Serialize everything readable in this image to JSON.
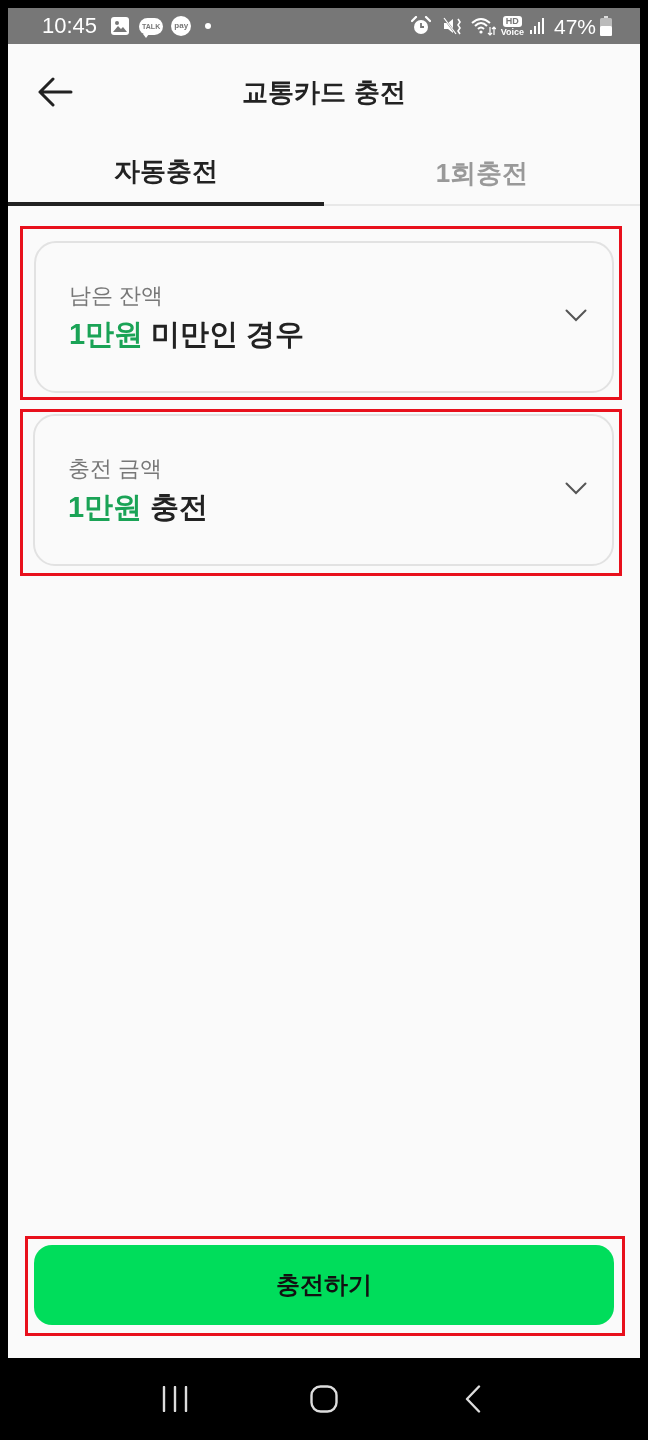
{
  "status_bar": {
    "time": "10:45",
    "talk_badge": "TALK",
    "pay_badge": "pay",
    "hd_badge": "HD",
    "voice_label": "Voice",
    "battery": "47%"
  },
  "header": {
    "title": "교통카드 충전"
  },
  "tabs": [
    {
      "label": "자동충전",
      "selected": true
    },
    {
      "label": "1회충전",
      "selected": false
    }
  ],
  "settings": [
    {
      "label": "남은 잔액",
      "value_highlight": "1만원",
      "value_rest": "미만인 경우",
      "highlighted": true
    },
    {
      "label": "충전 금액",
      "value_highlight": "1만원",
      "value_rest": "충전",
      "highlighted": true
    }
  ],
  "charge_button": {
    "label": "충전하기",
    "highlighted": true
  }
}
